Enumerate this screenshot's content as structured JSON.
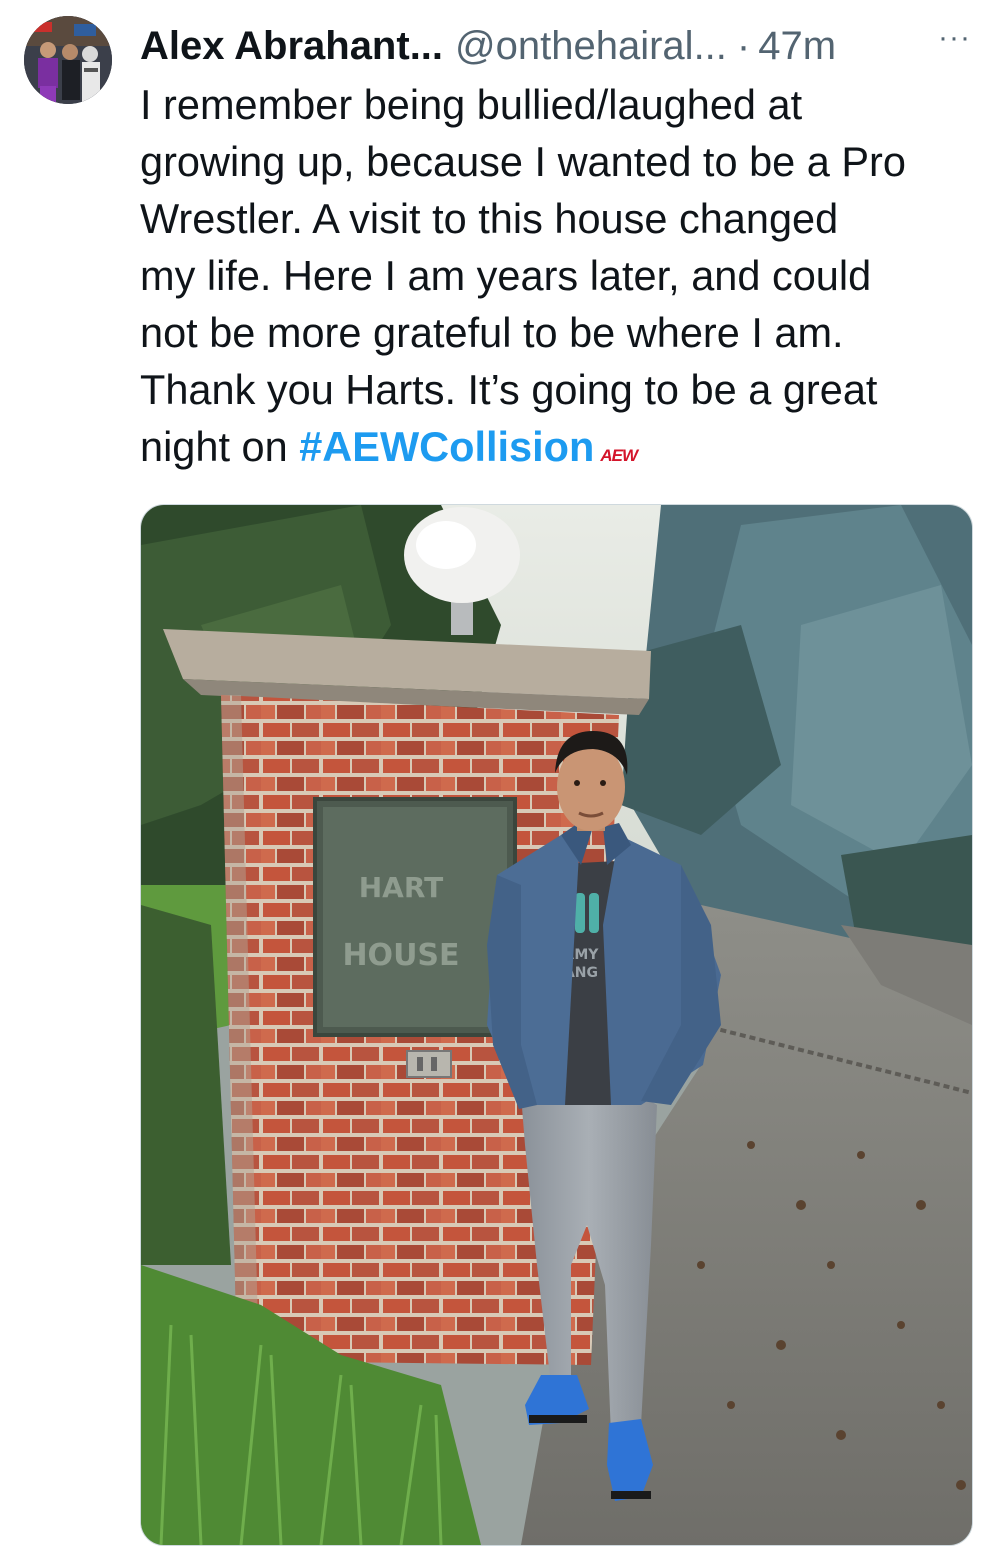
{
  "tweet": {
    "display_name": "Alex Abrahant...",
    "handle": "@onthehairal...",
    "separator": "·",
    "time_ago": "47m",
    "more_label": "···",
    "text_lines": [
      "I remember being bullied/laughed at",
      "growing up, because I wanted to be a Pro",
      "Wrestler. A visit to this house changed",
      "my life. Here I am years later, and could",
      "not be more grateful to be where I am.",
      "Thank you Harts. It’s going to be a great"
    ],
    "last_line_prefix": "night on ",
    "hashtag": "#AEWCollision",
    "hashtag_emoji_text": "AEW"
  },
  "photo": {
    "sign_line1": "HART",
    "sign_line2": "HOUSE",
    "shirt_text_1": "RMY",
    "shirt_text_2": "ANG"
  },
  "colors": {
    "accent": "#1d9bf0",
    "text": "#0f1419",
    "muted": "#536471",
    "border": "#cfd9de",
    "aew_red": "#d4142a"
  },
  "icons": {
    "more": "more-horizontal-icon",
    "avatar": "profile-photo"
  }
}
